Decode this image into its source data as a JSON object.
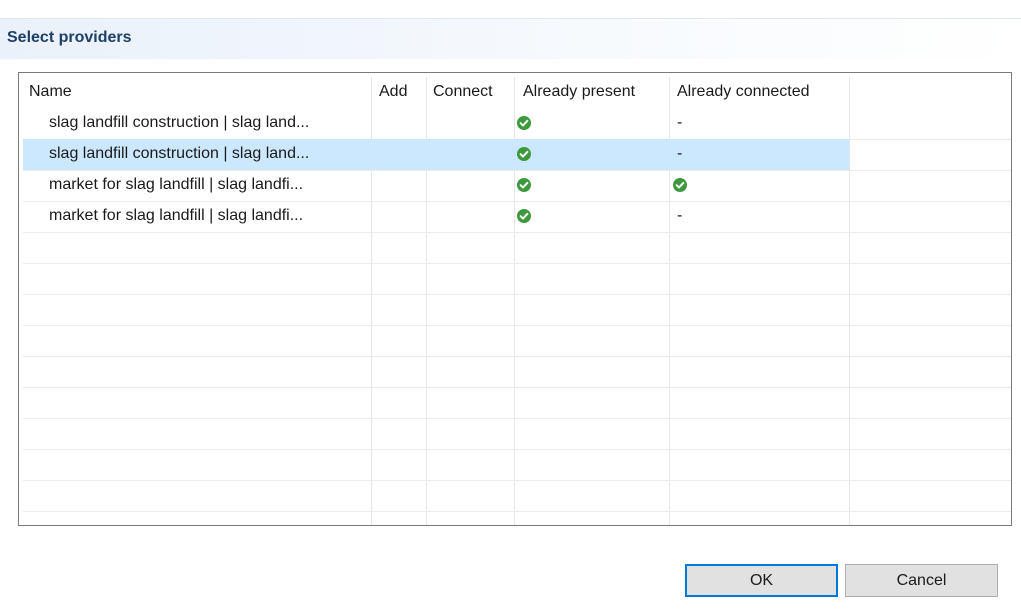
{
  "dialog": {
    "title": "Select providers"
  },
  "table": {
    "columns": [
      "Name",
      "Add",
      "Connect",
      "Already present",
      "Already connected"
    ],
    "rows": [
      {
        "name": "slag landfill construction | slag land...",
        "add": "",
        "connect": "",
        "already_present": "check",
        "already_connected": "-"
      },
      {
        "name": "slag landfill construction | slag land...",
        "add": "",
        "connect": "",
        "already_present": "check",
        "already_connected": "-",
        "selected": true
      },
      {
        "name": "market for slag landfill | slag landfi...",
        "add": "",
        "connect": "",
        "already_present": "check",
        "already_connected": "check"
      },
      {
        "name": "market for slag landfill | slag landfi...",
        "add": "",
        "connect": "",
        "already_present": "check",
        "already_connected": "-"
      }
    ]
  },
  "buttons": {
    "ok_label": "OK",
    "cancel_label": "Cancel"
  },
  "colors": {
    "selection": "#cce8ff",
    "check_green": "#3c9a3c",
    "title": "#1f3f66",
    "default_button_border": "#0078d7"
  },
  "icons": {
    "present": "check-circle-icon"
  }
}
